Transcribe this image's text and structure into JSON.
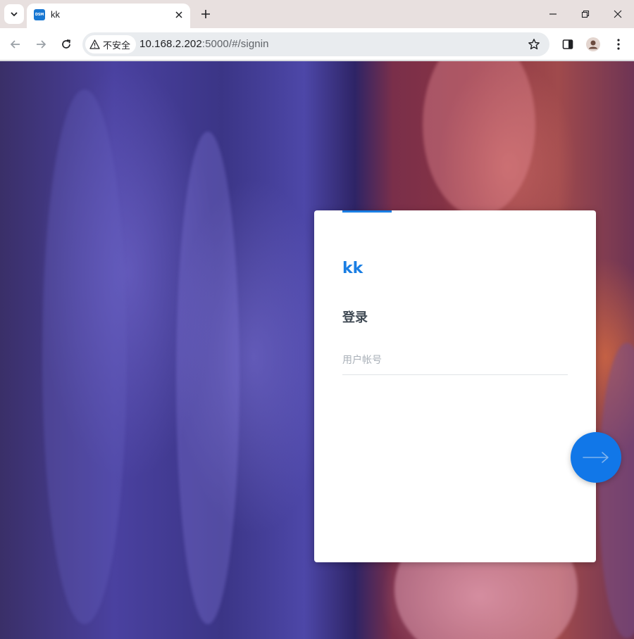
{
  "browser": {
    "tab": {
      "title": "kk",
      "favicon_text": "DSM",
      "favicon_color": "#1877d2"
    },
    "omnibox": {
      "security_label": "不安全",
      "url_host": "10.168.2.202",
      "url_rest": ":5000/#/signin"
    }
  },
  "login": {
    "title": "kk",
    "subtitle": "登录",
    "username_placeholder": "用户帐号",
    "username_value": "",
    "accent_color": "#1a7ee3",
    "next_button_icon": "arrow-right-icon"
  }
}
